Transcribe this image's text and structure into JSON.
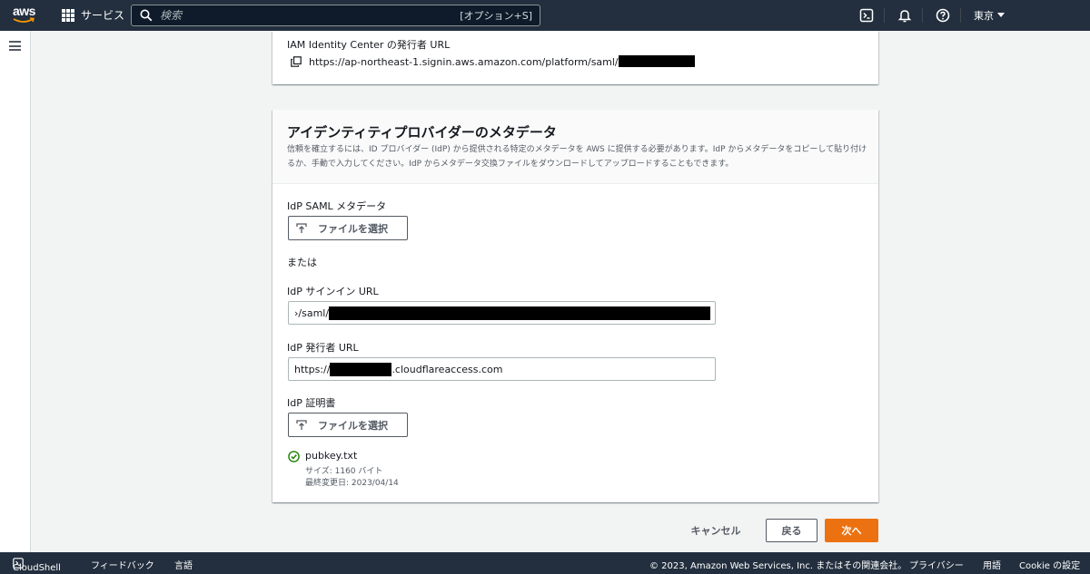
{
  "topnav": {
    "logo_text": "aws",
    "services_label": "サービス",
    "search_placeholder": "検索",
    "search_shortcut": "[オプション+S]",
    "region_label": "東京"
  },
  "issuer_panel": {
    "label": "IAM Identity Center の発行者 URL",
    "url_text": "https://ap-northeast-1.signin.aws.amazon.com/platform/saml/"
  },
  "metadata_panel": {
    "title": "アイデンティティプロバイダーのメタデータ",
    "description": "信頼を確立するには、ID プロバイダー (IdP) から提供される特定のメタデータを AWS に提供する必要があります。IdP からメタデータをコピーして貼り付けるか、手動で入力してください。IdP からメタデータ交換ファイルをダウンロードしてアップロードすることもできます。",
    "saml_metadata_label": "IdP SAML メタデータ",
    "file_button_label": "ファイルを選択",
    "or_label": "または",
    "signin_url_label": "IdP サインイン URL",
    "signin_url_value": "›/saml/",
    "issuer_url_label": "IdP 発行者 URL",
    "issuer_url_prefix": "https://",
    "issuer_url_suffix": ".cloudflareaccess.com",
    "certificate_label": "IdP 証明書",
    "cert_file_button_label": "ファイルを選択",
    "uploaded_file": {
      "name": "pubkey.txt",
      "size": "サイズ: 1160 バイト",
      "modified": "最終変更日: 2023/04/14"
    }
  },
  "actions": {
    "cancel_label": "キャンセル",
    "back_label": "戻る",
    "next_label": "次へ"
  },
  "footer": {
    "cloudshell_label": "CloudShell",
    "feedback_label": "フィードバック",
    "language_label": "言語",
    "copyright": "© 2023, Amazon Web Services, Inc. またはその関連会社。",
    "privacy_label": "プライバシー",
    "terms_label": "用語",
    "cookie_label": "Cookie の設定"
  },
  "colors": {
    "nav_bg": "#232f3e",
    "primary_button": "#ec7211",
    "success": "#1d8102"
  }
}
